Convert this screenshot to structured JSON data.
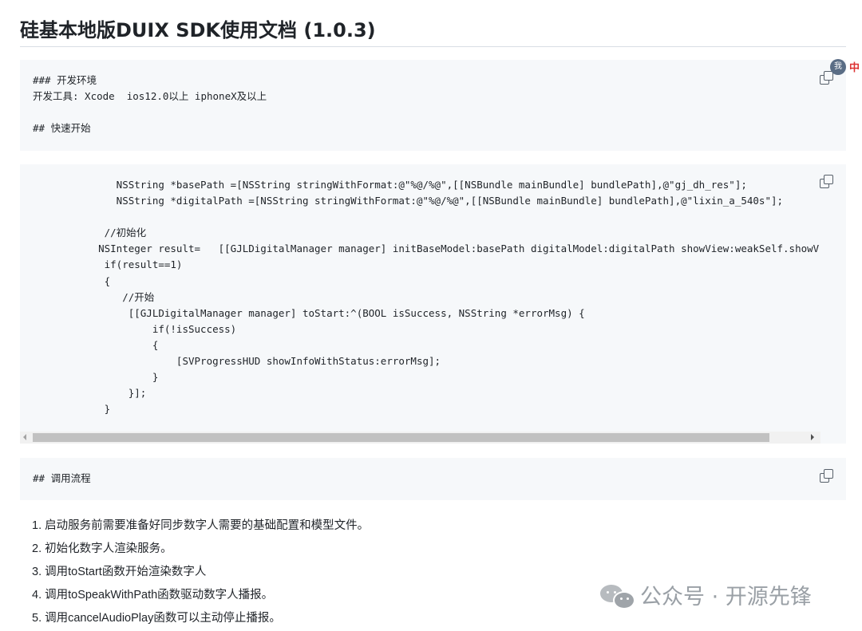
{
  "doc": {
    "title": "硅基本地版DUIX SDK使用文档 (1.0.3)"
  },
  "code_blocks": [
    {
      "lines": [
        "### 开发环境",
        "开发工具: Xcode  ios12.0以上 iphoneX及以上",
        "",
        "## 快速开始"
      ]
    },
    {
      "lines": [
        "       NSString *basePath =[NSString stringWithFormat:@\"%@/%@\",[[NSBundle mainBundle] bundlePath],@\"gj_dh_res\"];",
        "       NSString *digitalPath =[NSString stringWithFormat:@\"%@/%@\",[[NSBundle mainBundle] bundlePath],@\"lixin_a_540s\"];",
        "",
        "     //初始化",
        "    NSInteger result=   [[GJLDigitalManager manager] initBaseModel:basePath digitalModel:digitalPath showView:weakSelf.showV",
        "     if(result==1)",
        "     {",
        "        //开始",
        "         [[GJLDigitalManager manager] toStart:^(BOOL isSuccess, NSString *errorMsg) {",
        "             if(!isSuccess)",
        "             {",
        "                 [SVProgressHUD showInfoWithStatus:errorMsg];",
        "             }",
        "         }];",
        "     }"
      ]
    },
    {
      "lines": [
        "## 调用流程"
      ]
    }
  ],
  "steps": [
    "1. 启动服务前需要准备好同步数字人需要的基础配置和模型文件。",
    "2. 初始化数字人渲染服务。",
    "3. 调用toStart函数开始渲染数字人",
    "4. 调用toSpeakWithPath函数驱动数字人播报。",
    "5. 调用cancelAudioPlay函数可以主动停止播报。"
  ],
  "watermark": {
    "text": "公众号 · 开源先锋",
    "icon": "wechat-icon"
  },
  "extension": {
    "badge": "我",
    "lang": "中"
  },
  "icons": {
    "copy": "copy-icon"
  }
}
